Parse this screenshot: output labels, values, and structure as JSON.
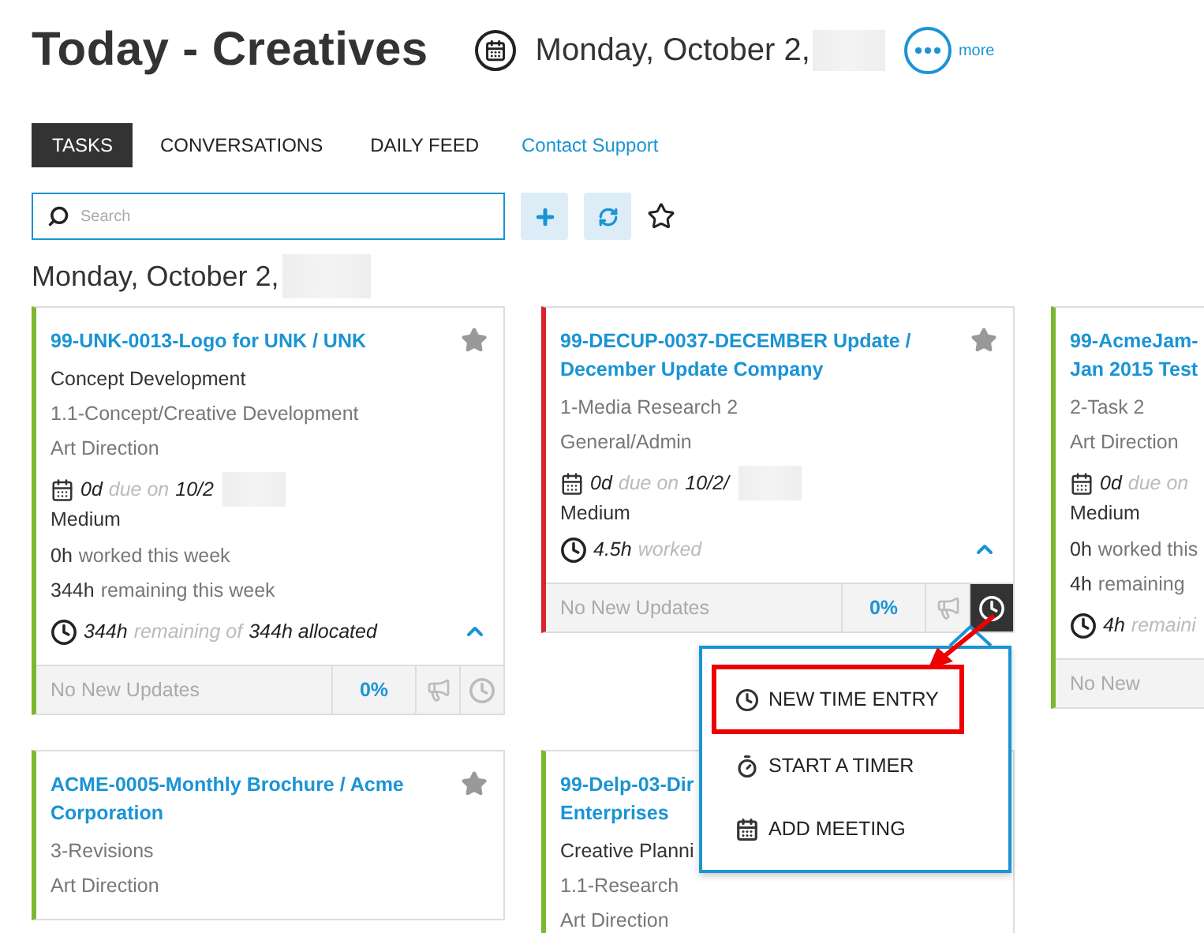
{
  "header": {
    "title": "Today - Creatives",
    "date": "Monday, October 2,",
    "date_redacted": true,
    "more_label": "more"
  },
  "tabs": [
    {
      "label": "TASKS",
      "selected": true
    },
    {
      "label": "CONVERSATIONS",
      "selected": false
    },
    {
      "label": "DAILY FEED",
      "selected": false
    }
  ],
  "support_link": "Contact Support",
  "search": {
    "placeholder": "Search"
  },
  "day_heading": {
    "text": "Monday, October 2,",
    "redacted": true
  },
  "cards": [
    {
      "title": "99-UNK-0013-Logo for UNK / UNK",
      "color": "#7cb82f",
      "star": true,
      "lines": [
        {
          "kind": "plain",
          "text": "Concept Development"
        },
        {
          "kind": "muted",
          "text": "1.1-Concept/Creative Development"
        },
        {
          "kind": "muted",
          "text": "Art Direction"
        },
        {
          "kind": "due",
          "days": "0d",
          "label": "due on",
          "date": "10/2",
          "redacted": true
        },
        {
          "kind": "priority",
          "text": "Medium"
        },
        {
          "kind": "hours",
          "value": "0h",
          "text": "worked this week"
        },
        {
          "kind": "hours",
          "value": "344h",
          "text": "remaining this week"
        },
        {
          "kind": "time",
          "parts": [
            {
              "text": "344h",
              "muted": false
            },
            {
              "text": "remaining of",
              "muted": true
            },
            {
              "text": "344h allocated",
              "muted": false
            }
          ],
          "expanded": true
        }
      ],
      "footer": {
        "updates": "No New Updates",
        "percent": "0%",
        "clock_active": false
      }
    },
    {
      "title": "99-DECUP-0037-DECEMBER Update / December Update Company",
      "color": "#d9232e",
      "star": true,
      "lines": [
        {
          "kind": "muted",
          "text": "1-Media Research 2"
        },
        {
          "kind": "muted",
          "text": "General/Admin"
        },
        {
          "kind": "due",
          "days": "0d",
          "label": "due on",
          "date": "10/2/",
          "redacted": true
        },
        {
          "kind": "priority",
          "text": "Medium"
        },
        {
          "kind": "time",
          "parts": [
            {
              "text": "4.5h",
              "muted": false
            },
            {
              "text": "worked",
              "muted": true
            }
          ],
          "expanded": true
        }
      ],
      "footer": {
        "updates": "No New Updates",
        "percent": "0%",
        "clock_active": true
      }
    },
    {
      "title": "99-AcmeJam-\nJan 2015 Test",
      "color": "#7cb82f",
      "lines": [
        {
          "kind": "muted",
          "text": "2-Task 2"
        },
        {
          "kind": "muted",
          "text": "Art Direction"
        },
        {
          "kind": "due",
          "days": "0d",
          "label": "due on",
          "redacted": false
        },
        {
          "kind": "priority",
          "text": "Medium"
        },
        {
          "kind": "hours",
          "value": "0h",
          "text": "worked this"
        },
        {
          "kind": "hours",
          "value": "4h",
          "text": "remaining"
        },
        {
          "kind": "time",
          "parts": [
            {
              "text": "4h",
              "muted": false
            },
            {
              "text": "remaini",
              "muted": true
            }
          ]
        }
      ],
      "footer": {
        "updates": "No New"
      }
    },
    {
      "title": "ACME-0005-Monthly Brochure / Acme Corporation",
      "color": "#7cb82f",
      "star": true,
      "lines": [
        {
          "kind": "muted",
          "text": "3-Revisions"
        },
        {
          "kind": "muted",
          "text": "Art Direction"
        }
      ]
    },
    {
      "title": "99-Delp-03-Dir\nEnterprises",
      "color": "#7cb82f",
      "lines": [
        {
          "kind": "plain",
          "text": "Creative Planni"
        },
        {
          "kind": "muted",
          "text": "1.1-Research"
        },
        {
          "kind": "muted",
          "text": "Art Direction"
        }
      ]
    }
  ],
  "time_menu": {
    "items": [
      {
        "kind": "clock",
        "label": "NEW TIME ENTRY",
        "highlighted": true
      },
      {
        "kind": "timer",
        "label": "START A TIMER",
        "highlighted": false
      },
      {
        "kind": "meeting",
        "label": "ADD MEETING",
        "highlighted": false
      }
    ]
  }
}
